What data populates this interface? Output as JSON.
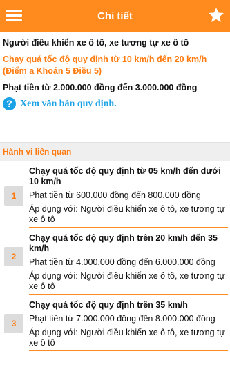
{
  "header": {
    "title": "Chi tiết",
    "menu_icon": "hamburger-menu-icon",
    "favorite_icon": "star-icon"
  },
  "detail": {
    "subject": "Người điều khiển xe ô tô, xe tương tự xe ô tô",
    "violation": "Chạy quá tốc độ quy định từ 10 km/h đến 20 km/h (Điểm a Khoản 5 Điều 5)",
    "penalty": "Phạt tiền từ 2.000.000 đồng đến 3.000.000 đồng",
    "doc_link_label": "Xem văn bản quy định."
  },
  "related": {
    "heading": "Hành vi liên quan",
    "items": [
      {
        "number": "1",
        "title": "Chạy quá tốc độ quy định từ 05 km/h đến dưới 10 km/h",
        "fine": "Phạt tiền từ 600.000 đồng đến 800.000 đồng",
        "applies": "Áp dụng với: Người điều khiển xe ô tô, xe tương tự xe ô tô"
      },
      {
        "number": "2",
        "title": "Chạy quá tốc độ quy định trên 20 km/h đến 35 km/h",
        "fine": "Phạt tiền từ 4.000.000 đồng đến 6.000.000 đồng",
        "applies": "Áp dụng với: Người điều khiển xe ô tô, xe tương tự xe ô tô"
      },
      {
        "number": "3",
        "title": "Chạy quá tốc độ quy định trên 35 km/h",
        "fine": "Phạt tiền từ 7.000.000 đồng đến 8.000.000 đồng",
        "applies": "Áp dụng với: Người điều khiển xe ô tô, xe tương tự xe ô tô"
      }
    ]
  },
  "colors": {
    "accent": "#ff8a1e",
    "link": "#1aa1e6"
  }
}
